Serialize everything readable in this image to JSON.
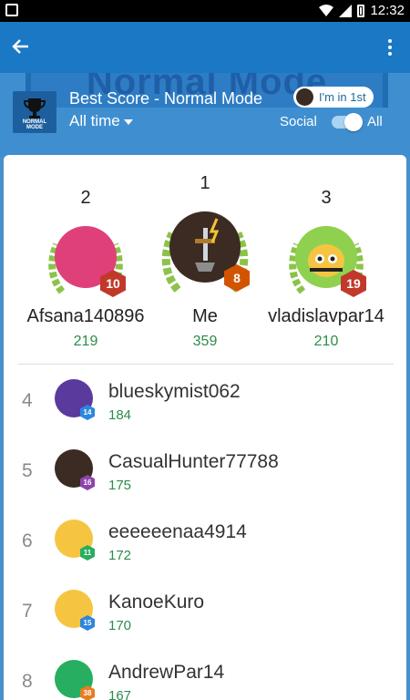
{
  "status_bar": {
    "time": "12:32"
  },
  "app_bar": {
    "back_icon": "arrow-left-icon",
    "menu_icon": "more-vert-icon"
  },
  "header": {
    "banner_text": "Normal Mode",
    "board_icon_text": "NORMAL MODE",
    "title": "Best Score - Normal Mode",
    "time_filter": "All time",
    "rank_badge": "I'm in 1st",
    "social_label": "Social",
    "all_label": "All"
  },
  "podium": [
    {
      "rank": "2",
      "name": "Afsana140896",
      "score": "219",
      "level": "10",
      "level_color": "#c0392b",
      "avatar_color": "#e0407a"
    },
    {
      "rank": "1",
      "name": "Me",
      "score": "359",
      "level": "8",
      "level_color": "#d35400",
      "avatar_color": "#3b2b22"
    },
    {
      "rank": "3",
      "name": "vladislavpar14",
      "score": "210",
      "level": "19",
      "level_color": "#c0392b",
      "avatar_color": "#8fd14f"
    }
  ],
  "list": [
    {
      "rank": "4",
      "name": "blueskymist062",
      "score": "184",
      "level": "14",
      "badge_color": "#2e86de",
      "avatar_color": "#5b3a9e"
    },
    {
      "rank": "5",
      "name": "CasualHunter77788",
      "score": "175",
      "level": "16",
      "badge_color": "#8e44ad",
      "avatar_color": "#3b2b22"
    },
    {
      "rank": "6",
      "name": "eeeeeenaa4914",
      "score": "172",
      "level": "11",
      "badge_color": "#27ae60",
      "avatar_color": "#f5c542"
    },
    {
      "rank": "7",
      "name": "KanoeKuro",
      "score": "170",
      "level": "15",
      "badge_color": "#2e86de",
      "avatar_color": "#f5c542"
    },
    {
      "rank": "8",
      "name": "AndrewPar14",
      "score": "167",
      "level": "38",
      "badge_color": "#e67e22",
      "avatar_color": "#27ae60"
    }
  ]
}
